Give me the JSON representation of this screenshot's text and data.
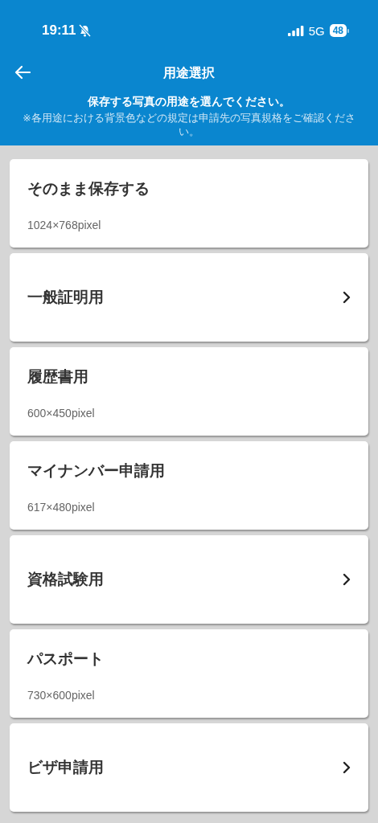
{
  "status_bar": {
    "time": "19:11",
    "network": "5G",
    "battery": "48"
  },
  "header": {
    "title": "用途選択",
    "instruction": "保存する写真の用途を選んでください。",
    "note": "※各用途における背景色などの規定は申請先の写真規格をご確認ください。"
  },
  "items": [
    {
      "kind": "size",
      "title": "そのまま保存する",
      "size": "1024×768pixel"
    },
    {
      "kind": "submenu",
      "title": "一般証明用"
    },
    {
      "kind": "size",
      "title": "履歴書用",
      "size": "600×450pixel"
    },
    {
      "kind": "size",
      "title": "マイナンバー申請用",
      "size": "617×480pixel"
    },
    {
      "kind": "submenu",
      "title": "資格試験用"
    },
    {
      "kind": "size",
      "title": "パスポート",
      "size": "730×600pixel"
    },
    {
      "kind": "submenu",
      "title": "ビザ申請用"
    }
  ]
}
